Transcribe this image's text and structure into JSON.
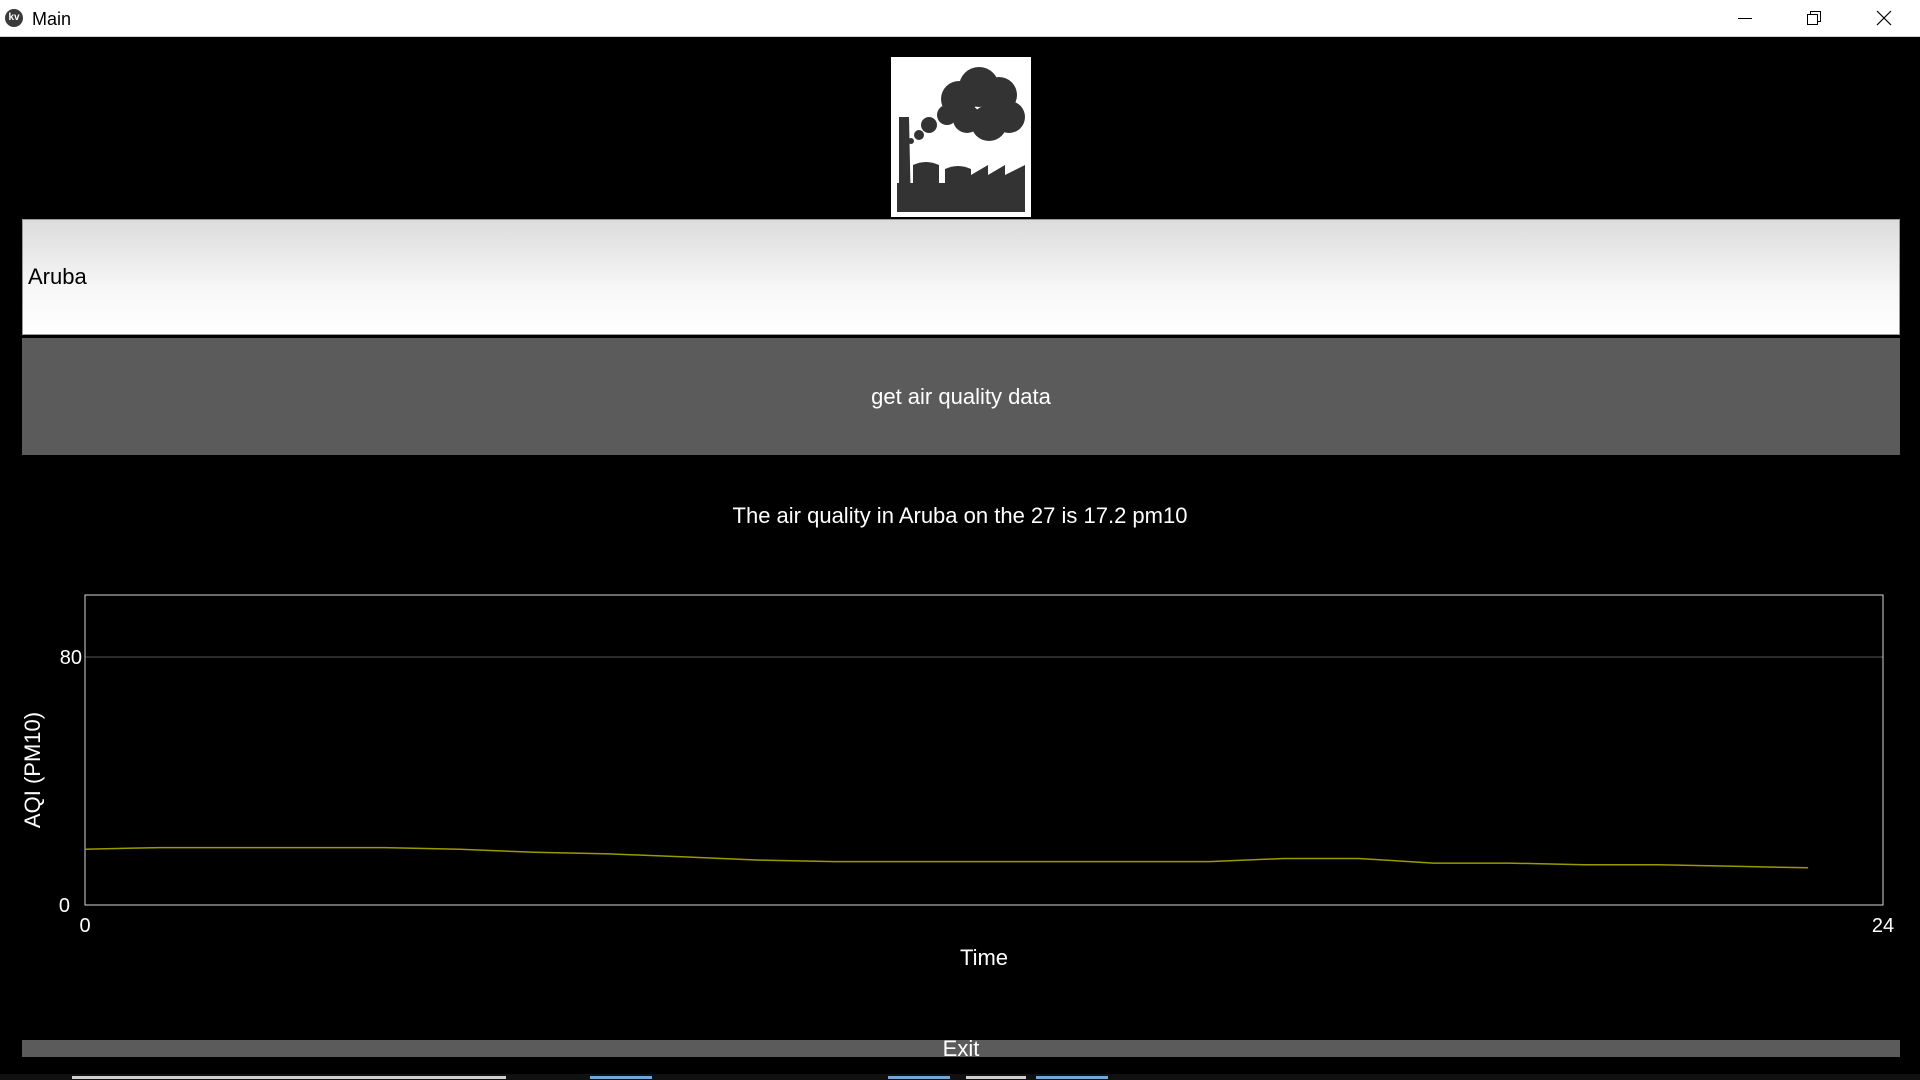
{
  "window": {
    "title": "Main",
    "app_icon_label": "kv"
  },
  "search": {
    "value": "Aruba"
  },
  "actions": {
    "get_label": "get air quality data",
    "exit_label": "Exit"
  },
  "result": {
    "text": "The air quality in Aruba on the 27 is 17.2 pm10"
  },
  "colors": {
    "background": "#000000",
    "button": "#5b5b5b",
    "series": "#9a9a00"
  },
  "chart_data": {
    "type": "line",
    "xlabel": "Time",
    "ylabel": "AQI (PM10)",
    "xlim": [
      0,
      24
    ],
    "ylim": [
      0,
      100
    ],
    "x_ticks": [
      "0",
      "24"
    ],
    "y_ticks": [
      "0",
      "80"
    ],
    "grid": "horizontal line at 80",
    "series": [
      {
        "x": [
          0,
          1,
          2,
          3,
          4,
          5,
          6,
          7,
          8,
          9,
          10,
          11,
          12,
          13,
          14,
          15,
          16,
          17,
          18,
          19,
          20,
          21,
          22,
          23
        ],
        "values": [
          18,
          18.5,
          18.5,
          18.5,
          18.5,
          18,
          17,
          16.5,
          15.5,
          14.5,
          14,
          14,
          14,
          14,
          14,
          14,
          15,
          15,
          13.5,
          13.5,
          13,
          13,
          12.5,
          12
        ]
      }
    ]
  }
}
